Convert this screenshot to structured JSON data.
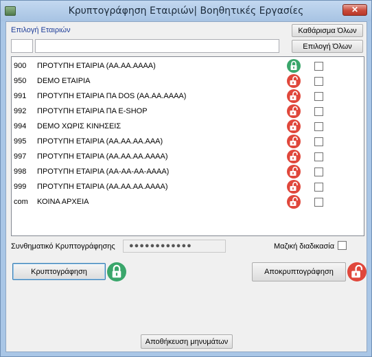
{
  "window": {
    "title": "Κρυπτογράφηση Εταιριών| Βοηθητικές Εργασίες",
    "close_glyph": "✕"
  },
  "companies_section": {
    "label": "Επιλογή Εταιριών",
    "clear_all_label": "Καθάρισμα Όλων",
    "select_all_label": "Επιλογή Όλων",
    "code_filter_value": "",
    "name_filter_value": ""
  },
  "companies": [
    {
      "code": "900",
      "name": "ΠΡΟΤΥΠΗ  ΕΤΑΙΡΙΑ (ΑΑ.ΑΑ.ΑΑΑΑ)",
      "lock_state": "unlocked",
      "lock_icon": "lock-open-green-icon",
      "selected": false
    },
    {
      "code": "950",
      "name": "DEMO ΕΤΑΙΡΙΑ",
      "lock_state": "locked",
      "lock_icon": "lock-red-icon",
      "selected": false
    },
    {
      "code": "991",
      "name": "ΠΡΟΤΥΠΗ ΕΤΑΙΡΙΑ ΠΑ DOS (ΑΑ.ΑΑ.ΑΑΑΑ)",
      "lock_state": "locked",
      "lock_icon": "lock-red-icon",
      "selected": false
    },
    {
      "code": "992",
      "name": "ΠΡΟΤΥΠΗ ΕΤΑΙΡΙΑ ΠΑ E-SHOP",
      "lock_state": "locked",
      "lock_icon": "lock-red-icon",
      "selected": false
    },
    {
      "code": "994",
      "name": "DEMO ΧΩΡΙΣ ΚΙΝΗΣΕΙΣ",
      "lock_state": "locked",
      "lock_icon": "lock-red-icon",
      "selected": false
    },
    {
      "code": "995",
      "name": "ΠΡΟΤΥΠΗ ΕΤΑΙΡΙΑ (ΑΑ.ΑΑ.ΑΑ.ΑΑΑ)",
      "lock_state": "locked",
      "lock_icon": "lock-red-icon",
      "selected": false
    },
    {
      "code": "997",
      "name": "ΠΡΟΤΥΠΗ ΕΤΑΙΡΙΑ (ΑΑ.ΑΑ.ΑΑ.ΑΑΑΑ)",
      "lock_state": "locked",
      "lock_icon": "lock-red-icon",
      "selected": false
    },
    {
      "code": "998",
      "name": "ΠΡΟΤΥΠΗ ΕΤΑΙΡΙΑ (ΑΑ-ΑΑ-ΑΑ-ΑΑΑΑ)",
      "lock_state": "locked",
      "lock_icon": "lock-red-icon",
      "selected": false
    },
    {
      "code": "999",
      "name": "ΠΡΟΤΥΠΗ ΕΤΑΙΡΙΑ (ΑΑ.ΑΑ.ΑΑ.ΑΑΑΑ)",
      "lock_state": "locked",
      "lock_icon": "lock-red-icon",
      "selected": false
    },
    {
      "code": "com",
      "name": "ΚΟΙΝΑ ΑΡΧΕΙΑ",
      "lock_state": "locked",
      "lock_icon": "lock-red-icon",
      "selected": false
    }
  ],
  "password": {
    "label": "Συνθηματικό Κρυπτογράφησης",
    "masked_value": "●●●●●●●●●●●●"
  },
  "mass_process": {
    "label": "Μαζική διαδικασία",
    "checked": false
  },
  "actions": {
    "encrypt_label": "Κρυπτογράφηση",
    "decrypt_label": "Αποκρυπτογράφηση",
    "save_messages_label": "Αποθήκευση μηνυμάτων"
  },
  "colors": {
    "unlocked_green": "#3aa66b",
    "locked_red": "#e0473b",
    "section_label_blue": "#1d3d99"
  }
}
